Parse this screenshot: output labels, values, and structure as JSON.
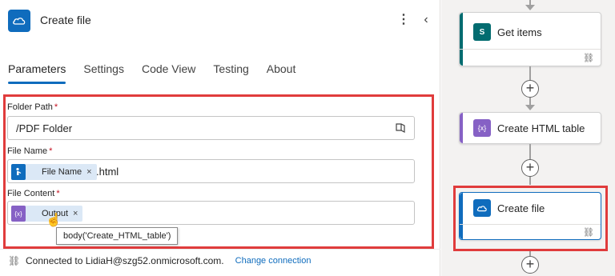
{
  "header": {
    "title": "Create file",
    "more_icon": "more-vertical-icon",
    "collapse_icon": "chevron-left-icon"
  },
  "tabs": [
    {
      "label": "Parameters",
      "active": true
    },
    {
      "label": "Settings",
      "active": false
    },
    {
      "label": "Code View",
      "active": false
    },
    {
      "label": "Testing",
      "active": false
    },
    {
      "label": "About",
      "active": false
    }
  ],
  "fields": {
    "folder_path": {
      "label": "Folder Path",
      "required": "*",
      "value": "/PDF Folder"
    },
    "file_name": {
      "label": "File Name",
      "required": "*",
      "token": "File Name",
      "token_remove": "×",
      "suffix": ".html"
    },
    "file_content": {
      "label": "File Content",
      "required": "*",
      "token": "Output",
      "token_remove": "×"
    }
  },
  "tooltip": "body('Create_HTML_table')",
  "connection": {
    "text": "Connected to LidiaH@szg52.onmicrosoft.com.",
    "change_label": "Change connection"
  },
  "flow": {
    "cards": [
      {
        "title": "Get items",
        "accent": "#036c70"
      },
      {
        "title": "Create HTML table",
        "accent": "#8661c5"
      },
      {
        "title": "Create file",
        "accent": "#0f6cbd"
      }
    ]
  },
  "colors": {
    "accent": "#0f6cbd",
    "highlight": "#e03c3c",
    "token_bg": "#dbe8f6"
  }
}
